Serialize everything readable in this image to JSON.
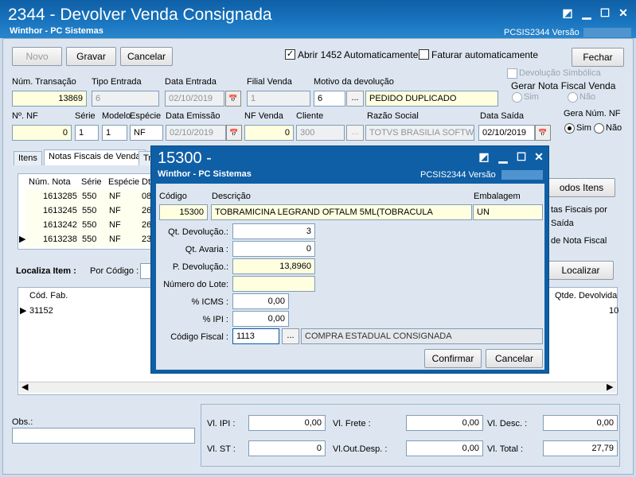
{
  "window": {
    "title": "2344 - Devolver Venda Consignada",
    "subtitle": "Winthor - PC Sistemas",
    "routine": "PCSIS2344  Versão"
  },
  "toolbar": {
    "novo": "Novo",
    "gravar": "Gravar",
    "cancelar": "Cancelar",
    "fechar": "Fechar",
    "abrir_1452": "Abrir 1452 Automaticamente",
    "faturar_auto": "Faturar automaticamente"
  },
  "options": {
    "devolucao_simbolica": "Devolução Simbólica",
    "gerar_nf_venda": "Gerar Nota Fiscal Venda",
    "sim": "Sim",
    "nao": "Não",
    "gera_num_nf": "Gera Núm. NF"
  },
  "header": {
    "num_transacao_label": "Núm. Transação",
    "num_transacao": "13869",
    "tipo_entrada_label": "Tipo Entrada",
    "tipo_entrada": "6",
    "data_entrada_label": "Data Entrada",
    "data_entrada": "02/10/2019",
    "filial_venda_label": "Filial Venda",
    "filial_venda": "1",
    "motivo_label": "Motivo da devolução",
    "motivo_code": "6",
    "motivo_desc": "PEDIDO DUPLICADO",
    "num_nf_label": "Nº. NF",
    "num_nf": "0",
    "serie_label": "Série",
    "serie": "1",
    "modelo_label": "Modelo",
    "modelo": "1",
    "especie_label": "Espécie",
    "especie": "NF",
    "data_emissao_label": "Data Emissão",
    "data_emissao": "02/10/2019",
    "nf_venda_label": "NF Venda",
    "nf_venda": "0",
    "cliente_label": "Cliente",
    "cliente": "300",
    "razao_label": "Razão Social",
    "razao": "TOTVS BRASILIA SOFTWARE LTD",
    "data_saida_label": "Data Saída",
    "data_saida": "02/10/2019"
  },
  "tabs": {
    "itens": "Itens",
    "notas": "Notas Fiscais de Venda",
    "tr": "Tr"
  },
  "notes_grid": {
    "headers": [
      "Núm. Nota",
      "Série",
      "Espécie",
      "Dt"
    ],
    "rows": [
      {
        "nota": "1613285",
        "serie": "550",
        "especie": "NF",
        "dt": "08"
      },
      {
        "nota": "1613245",
        "serie": "550",
        "especie": "NF",
        "dt": "26"
      },
      {
        "nota": "1613242",
        "serie": "550",
        "especie": "NF",
        "dt": "26"
      },
      {
        "nota": "1613238",
        "serie": "550",
        "especie": "NF",
        "dt": "23"
      }
    ]
  },
  "right_panel": {
    "todos_itens": "odos Itens",
    "tas_fiscais_por": "tas Fiscais por",
    "saida": "Saída",
    "de_nota_fiscal": "de Nota Fiscal",
    "localizar": "Localizar"
  },
  "localiza": {
    "label": "Localiza Item :",
    "por_codigo": "Por Código :"
  },
  "items_grid": {
    "col1": "Cód. Fab.",
    "col2": "Qtde. Devolvida",
    "row_cod": "31152",
    "row_qtde": "10"
  },
  "footer": {
    "obs_label": "Obs.:",
    "vl_ipi_label": "Vl. IPI :",
    "vl_ipi": "0,00",
    "vl_frete_label": "Vl. Frete :",
    "vl_frete": "0,00",
    "vl_desc_label": "Vl. Desc. :",
    "vl_desc": "0,00",
    "vl_st_label": "Vl. ST :",
    "vl_st": "0",
    "vl_out_label": "Vl.Out.Desp. :",
    "vl_out": "0,00",
    "vl_total_label": "Vl. Total :",
    "vl_total": "27,79"
  },
  "dialog": {
    "title": "15300 -",
    "subtitle": "Winthor - PC Sistemas",
    "routine": "PCSIS2344  Versão",
    "codigo_label": "Código",
    "codigo": "15300",
    "descricao_label": "Descrição",
    "descricao": "TOBRAMICINA LEGRAND OFTALM 5ML(TOBRACULA",
    "embalagem_label": "Embalagem",
    "embalagem": "UN",
    "qt_dev_label": "Qt. Devolução.:",
    "qt_dev": "3",
    "qt_avaria_label": "Qt. Avaria :",
    "qt_avaria": "0",
    "p_dev_label": "P. Devolução.:",
    "p_dev": "13,8960",
    "lote_label": "Número do Lote:",
    "lote": "",
    "icms_label": "% ICMS :",
    "icms": "0,00",
    "ipi_label": "% IPI :",
    "ipi": "0,00",
    "cfop_label": "Código Fiscal :",
    "cfop": "1113",
    "cfop_desc": "COMPRA ESTADUAL CONSIGNADA",
    "confirmar": "Confirmar",
    "cancelar": "Cancelar"
  }
}
